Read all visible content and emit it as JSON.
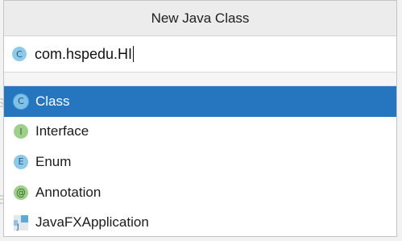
{
  "dialog": {
    "title": "New Java Class"
  },
  "name_field": {
    "icon_letter": "C",
    "value": "com.hspedu.HI"
  },
  "kinds": [
    {
      "label": "Class",
      "icon": "class-icon",
      "icon_letter": "C",
      "selected": true
    },
    {
      "label": "Interface",
      "icon": "interface-icon",
      "icon_letter": "I",
      "selected": false
    },
    {
      "label": "Enum",
      "icon": "enum-icon",
      "icon_letter": "E",
      "selected": false
    },
    {
      "label": "Annotation",
      "icon": "annotation-icon",
      "icon_letter": "@",
      "selected": false
    },
    {
      "label": "JavaFXApplication",
      "icon": "javafx-application-icon",
      "icon_letter": "J",
      "selected": false
    }
  ],
  "colors": {
    "selection": "#2675bf",
    "class_badge": "#8ec9ea",
    "interface_badge": "#9fd08b"
  }
}
